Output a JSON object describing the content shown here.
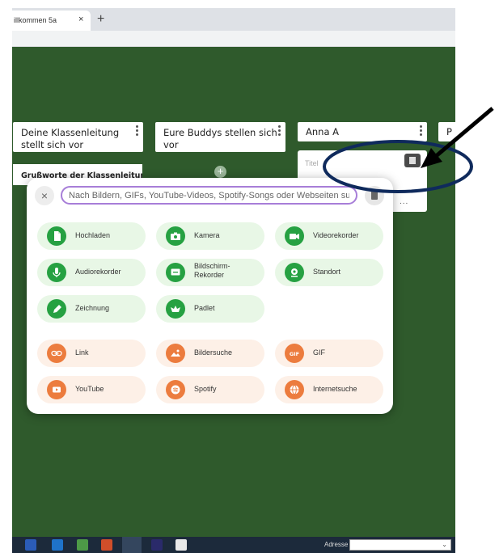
{
  "browser": {
    "tab_title": "illkommen 5a",
    "tab_close": "×",
    "new_tab": "+"
  },
  "board": {
    "background_color": "#2f5a2c",
    "columns": [
      {
        "title": "Deine Klassenleitung stellt sich vor",
        "card": "Grußworte der Klassenleitung"
      },
      {
        "title": "Eure Buddys stellen sich vor"
      },
      {
        "title": "Anna A"
      },
      {
        "title": "P"
      }
    ],
    "add_icon": "plus-icon",
    "title_placeholder": "Titel",
    "more_label": "..."
  },
  "popup": {
    "close_label": "×",
    "search_placeholder": "Nach Bildern, GIFs, YouTube-Videos, Spotify-Songs oder Webseiten suchen",
    "options_green": [
      {
        "label": "Hochladen",
        "icon": "upload-icon"
      },
      {
        "label": "Kamera",
        "icon": "camera-icon"
      },
      {
        "label": "Videorekorder",
        "icon": "video-icon"
      },
      {
        "label": "Audiorekorder",
        "icon": "microphone-icon"
      },
      {
        "label": "Bildschirm-\nRekorder",
        "icon": "screen-recorder-icon"
      },
      {
        "label": "Standort",
        "icon": "location-icon"
      },
      {
        "label": "Zeichnung",
        "icon": "drawing-icon"
      },
      {
        "label": "Padlet",
        "icon": "padlet-icon"
      }
    ],
    "options_orange": [
      {
        "label": "Link",
        "icon": "link-icon"
      },
      {
        "label": "Bildersuche",
        "icon": "image-search-icon"
      },
      {
        "label": "GIF",
        "icon": "gif-icon"
      },
      {
        "label": "YouTube",
        "icon": "youtube-icon"
      },
      {
        "label": "Spotify",
        "icon": "spotify-icon"
      },
      {
        "label": "Internetsuche",
        "icon": "web-search-icon"
      }
    ],
    "accent_green": "#26a142",
    "accent_orange": "#ec7c3e"
  },
  "taskbar": {
    "address_label": "Adresse",
    "address_caret": "⌄"
  }
}
